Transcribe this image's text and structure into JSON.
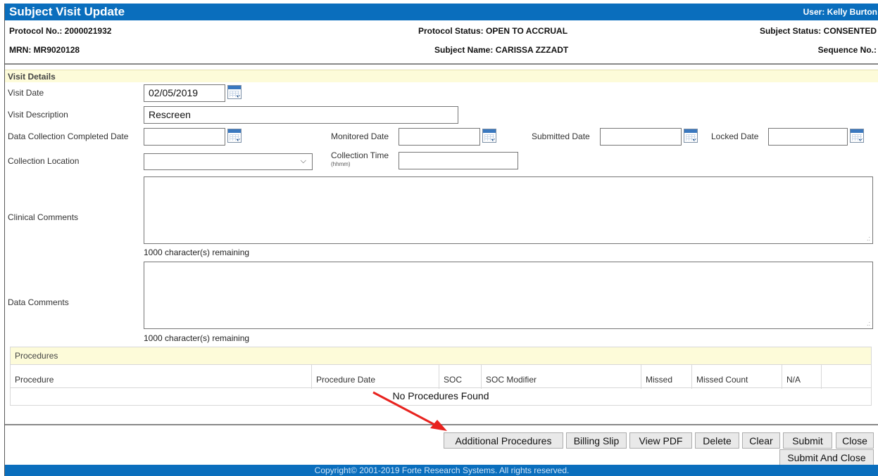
{
  "window": {
    "title": "Subject Visit Update",
    "user": "User: Kelly Burton"
  },
  "header": {
    "protocol_no_label": "Protocol No.:",
    "protocol_no": "2000021932",
    "protocol_status_label": "Protocol Status:",
    "protocol_status": "OPEN TO ACCRUAL",
    "subject_status_label": "Subject Status:",
    "subject_status": "CONSENTED",
    "mrn_label": "MRN:",
    "mrn": "MR9020128",
    "subject_name_label": "Subject Name:",
    "subject_name": "CARISSA ZZZADT",
    "sequence_label": "Sequence No.:",
    "sequence": ""
  },
  "visit_details": {
    "section_title": "Visit Details",
    "visit_date_label": "Visit Date",
    "visit_date": "02/05/2019",
    "visit_description_label": "Visit Description",
    "visit_description": "Rescreen",
    "dcc_date_label": "Data Collection Completed Date",
    "dcc_date": "",
    "monitored_date_label": "Monitored Date",
    "monitored_date": "",
    "submitted_date_label": "Submitted Date",
    "submitted_date": "",
    "locked_date_label": "Locked Date",
    "locked_date": "",
    "collection_location_label": "Collection Location",
    "collection_location": "",
    "collection_time_label": "Collection Time",
    "collection_time_hint": "(hhmm)",
    "collection_time": "",
    "clinical_comments_label": "Clinical Comments",
    "clinical_comments": "",
    "clinical_remaining": "1000 character(s) remaining",
    "data_comments_label": "Data Comments",
    "data_comments": "",
    "data_remaining": "1000 character(s) remaining"
  },
  "procedures": {
    "title": "Procedures",
    "columns": [
      "Procedure",
      "Procedure Date",
      "SOC",
      "SOC Modifier",
      "Missed",
      "Missed Count",
      "N/A",
      ""
    ],
    "empty_message": "No Procedures Found"
  },
  "buttons": {
    "additional_procedures": "Additional Procedures",
    "billing_slip": "Billing Slip",
    "view_pdf": "View PDF",
    "delete": "Delete",
    "clear": "Clear",
    "submit": "Submit",
    "close": "Close",
    "submit_and_close": "Submit And Close"
  },
  "footer": {
    "copyright": "Copyright© 2001-2019 Forte Research Systems. All rights reserved."
  },
  "colors": {
    "title_bar": "#0a6ebd",
    "section_bg": "#fdfbd9",
    "arrow": "#e8231f"
  }
}
